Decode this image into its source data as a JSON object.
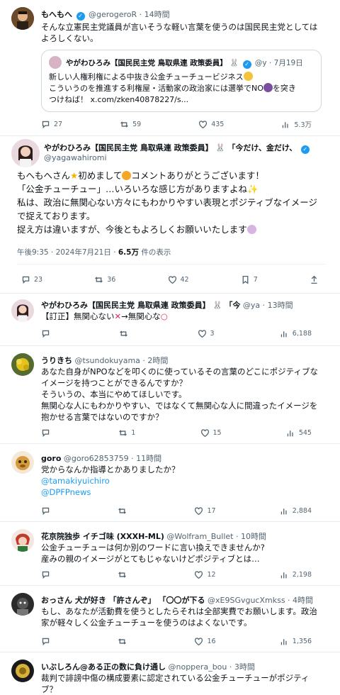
{
  "t1": {
    "name": "もへもへ",
    "handle": "@gerogeroR · 14時間",
    "text1": "そんな立憲民主党議員が言いそうな軽い言葉を使うのは国民民主党としては",
    "text2": "よろしくない。",
    "quote": {
      "name": "やがわひろみ【国民民主党 鳥取県連 政策委員】",
      "handle": "@y · 7月19日",
      "line1": "新しい人権利権による中抜き公金チューチュービジネス",
      "line2": "こういうのを推進する利権屋・活動家の政治家には選挙でNO",
      "line2b": "を突き",
      "line3a": "つけねば！ ",
      "line3b": "x.com/zken40878227/s..."
    },
    "replies": "27",
    "reposts": "59",
    "likes": "435",
    "views": "5.3万"
  },
  "main": {
    "name": "やがわひろみ【国民民主党 鳥取県連 政策委員】",
    "name_suffix": "「今だけ、金だけ、",
    "handle": "@yagawahiromi",
    "line1a": "もへもへさん",
    "line1b": "初めまして",
    "line1c": "コメントありがとうございます！",
    "line2": "「公金チューチュー」…いろいろな感じ方がありますよね",
    "line3": "私は、政治に無関心ない方々にもわかりやすい表現とポジティブなイメージ",
    "line4": "で捉えております。",
    "line5": "捉え方は違いますが、今後ともよろしくお願いいたします",
    "meta_time": "午後9:35 · 2024年7月21日 · ",
    "meta_views": "6.5万",
    "meta_views_label": " 件の表示",
    "replies": "23",
    "reposts": "36",
    "likes": "42",
    "bookmarks": "7"
  },
  "t3": {
    "name": "やがわひろみ【国民民主党 鳥取県連 政策委員】",
    "name_suffix": "「今",
    "handle": "@ya · 13時間",
    "text_a": "【訂正】無関心ない",
    "text_b": "→無関心な",
    "replies": "",
    "reposts": "",
    "likes": "3",
    "views": "6,188"
  },
  "t4": {
    "name": "うりきち",
    "handle": "@tsundokuyama · 2時間",
    "lines": [
      "あなた自身がNPOなどを叩くのに使っているその言葉のどこにポジティブな",
      "イメージを持つことができるんですか？",
      "そういうの、本当にやめてほしいです。",
      "無関心な人にもわかりやすい、ではなくて無関心な人に間違ったイメージを",
      "抱かせる言葉ではないのですか？"
    ],
    "replies": "",
    "reposts": "1",
    "likes": "15",
    "views": "545"
  },
  "t5": {
    "name": "goro",
    "handle": "@goro62853759 · 11時間",
    "text": "党からなんか指導とかありましたか？",
    "link1": "@tamakiyuichiro",
    "link2": "@DPFPnews",
    "replies": "",
    "reposts": "",
    "likes": "17",
    "views": "2,884"
  },
  "t6": {
    "name": "花京院独歩 イチゴ味 (XXXH-ML)",
    "handle": "@Wolfram_Bullet · 10時間",
    "line1": "公金チューチューは何か別のワードに言い換えできませんか?",
    "line2": "産みの親のイメージがとてもじゃないけどポジティブとは…",
    "replies": "",
    "reposts": "",
    "likes": "12",
    "views": "2,198"
  },
  "t7": {
    "name": "おっさん 犬が好き 「許さんぞ」 「〇〇が下る",
    "handle": "@xE9SGvgucXmkss · 4時間",
    "line1": "もし、あなたが活動費を使うとしたらそれは全部実費でお願いします。政治",
    "line2": "家が軽々しく公金チューチューを使うのはよくないです。",
    "replies": "",
    "reposts": "",
    "likes": "16",
    "views": "1,356"
  },
  "t8": {
    "name": "いぶしろん@ある正の数に負け通し",
    "handle": "@noppera_bou · 3時間",
    "line1": "裁判で誹謗中傷の構成要素に認定されている公金チューチューがポジティ",
    "line2": "ブ？"
  }
}
